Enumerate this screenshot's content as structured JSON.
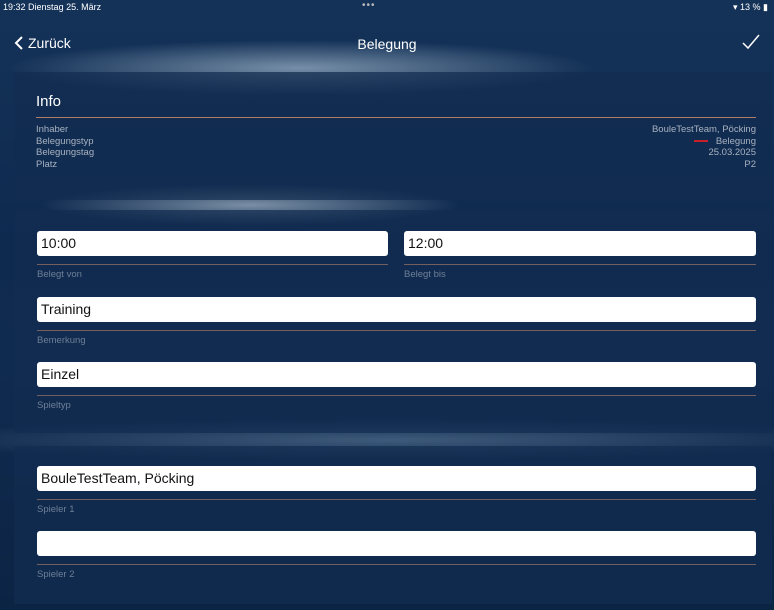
{
  "status": {
    "time": "19:32",
    "date": "Dienstag 25. März",
    "dots": "•••",
    "battery": "13 %"
  },
  "nav": {
    "back_label": "Zurück",
    "title": "Belegung"
  },
  "info": {
    "title": "Info",
    "rows": [
      {
        "label": "Inhaber",
        "value": "BouleTestTeam, Pöcking"
      },
      {
        "label": "Belegungstyp",
        "value": "Belegung",
        "color": "#c8202a"
      },
      {
        "label": "Belegungstag",
        "value": "25.03.2025"
      },
      {
        "label": "Platz",
        "value": "P2"
      }
    ]
  },
  "form": {
    "from": {
      "value": "10:00",
      "label": "Belegt von"
    },
    "to": {
      "value": "12:00",
      "label": "Belegt bis"
    },
    "remark": {
      "value": "Training",
      "label": "Bemerkung"
    },
    "gametype": {
      "value": "Einzel",
      "label": "Spieltyp"
    }
  },
  "players": {
    "p1": {
      "value": "BouleTestTeam, Pöcking",
      "label": "Spieler 1"
    },
    "p2": {
      "value": "",
      "label": "Spieler 2"
    }
  }
}
